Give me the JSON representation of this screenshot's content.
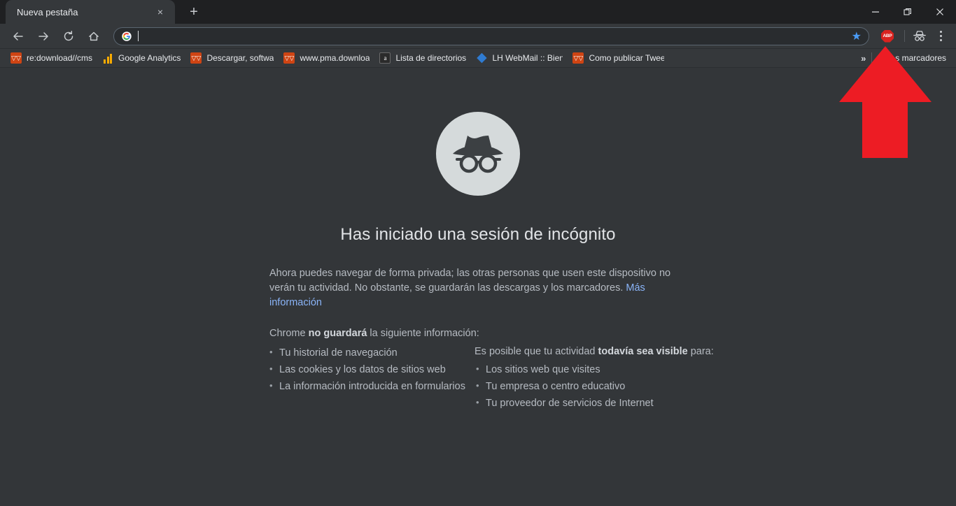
{
  "window": {
    "controls": [
      {
        "name": "minimize",
        "glyph": "minimize-icon"
      },
      {
        "name": "restore",
        "glyph": "restore-icon"
      },
      {
        "name": "close",
        "glyph": "close-icon"
      }
    ]
  },
  "tabstrip": {
    "tabs": [
      {
        "title": "Nueva pestaña",
        "close_label": "×",
        "active": true
      }
    ],
    "new_tab_label": "+"
  },
  "toolbar": {
    "back_icon": "arrow-left-icon",
    "forward_icon": "arrow-right-icon",
    "reload_icon": "reload-icon",
    "home_icon": "home-icon",
    "omnibox": {
      "value": "",
      "placeholder": "",
      "leading_icon": "google-g-icon",
      "bookmark_star_icon": "star-icon"
    },
    "extensions": [
      {
        "name": "adblock-plus",
        "label": "ABP",
        "color": "#d9231f"
      }
    ],
    "incognito_indicator_icon": "incognito-icon",
    "menu_icon": "three-dot-menu-icon"
  },
  "bookmarks_bar": {
    "items": [
      {
        "label": "re:download//cms",
        "favicon": "firefox-download-icon"
      },
      {
        "label": "Google Analytics",
        "favicon": "google-analytics-icon"
      },
      {
        "label": "Descargar, software,",
        "favicon": "firefox-download-icon"
      },
      {
        "label": "www.pma.download.",
        "favicon": "firefox-download-icon"
      },
      {
        "label": "Lista de directorios d",
        "favicon": "apache-directory-icon"
      },
      {
        "label": "LH WebMail :: Bienve",
        "favicon": "webmail-icon"
      },
      {
        "label": "Como publicar Tweet",
        "favicon": "firefox-download-icon"
      }
    ],
    "overflow_label": "»",
    "other_bookmarks": {
      "label": "Otros marcadores",
      "visible_text": "s marcadores",
      "icon": "folder-icon"
    }
  },
  "page": {
    "avatar_icon": "incognito-avatar-icon",
    "heading": "Has iniciado una sesión de incógnito",
    "intro_part1": "Ahora puedes navegar de forma privada; las otras personas que usen este dispositivo no verán tu actividad. No obstante, se guardarán las descargas y los marcadores. ",
    "intro_link": "Más información",
    "not_saved_prefix": "Chrome ",
    "not_saved_bold": "no guardará",
    "not_saved_suffix": " la siguiente información:",
    "not_saved_items": [
      "Tu historial de navegación",
      "Las cookies y los datos de sitios web",
      "La información introducida en formularios"
    ],
    "visible_prefix": "Es posible que tu actividad ",
    "visible_bold": "todavía sea visible",
    "visible_suffix": " para:",
    "visible_items": [
      "Los sitios web que visites",
      "Tu empresa o centro educativo",
      "Tu proveedor de servicios de Internet"
    ]
  },
  "annotation": {
    "type": "red-arrow",
    "color": "#ed1c24",
    "points_to": "incognito-indicator-icon"
  },
  "colors": {
    "tabstrip_bg": "#1f2022",
    "toolbar_bg": "#35383b",
    "page_bg": "#333639",
    "link": "#8ab4f8",
    "text": "#b6bbc2",
    "heading": "#e2e4e7",
    "arrow": "#ed1c24"
  }
}
